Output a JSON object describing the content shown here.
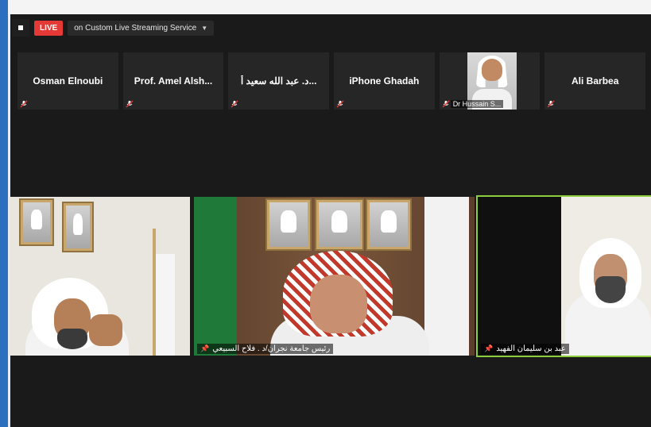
{
  "topbar": {
    "live_badge": "LIVE",
    "service_label": "on Custom Live Streaming Service",
    "caret": "▼"
  },
  "participants_strip": [
    {
      "name": "Osman Elnoubi",
      "muted": true
    },
    {
      "name": "Prof. Amel Alsh...",
      "muted": true
    },
    {
      "name": "د. عبد الله سعيد أ...",
      "muted": true
    },
    {
      "name": "iPhone Ghadah",
      "muted": true
    },
    {
      "name": "Dr Hussain S...",
      "muted": true,
      "video": true
    },
    {
      "name": "Ali Barbea",
      "muted": true
    }
  ],
  "main_videos": [
    {
      "caption": ""
    },
    {
      "caption": "رئيس جامعة نجران/د . فلاح السبيعي"
    },
    {
      "caption": "عبد بن سليمان الفهيد"
    }
  ],
  "icons": {
    "mic_muted": "mic-muted-icon",
    "pin": "📌"
  },
  "colors": {
    "live_red": "#e53935",
    "active_speaker": "#8ccf3d",
    "accent_blue": "#2c6fbe"
  }
}
